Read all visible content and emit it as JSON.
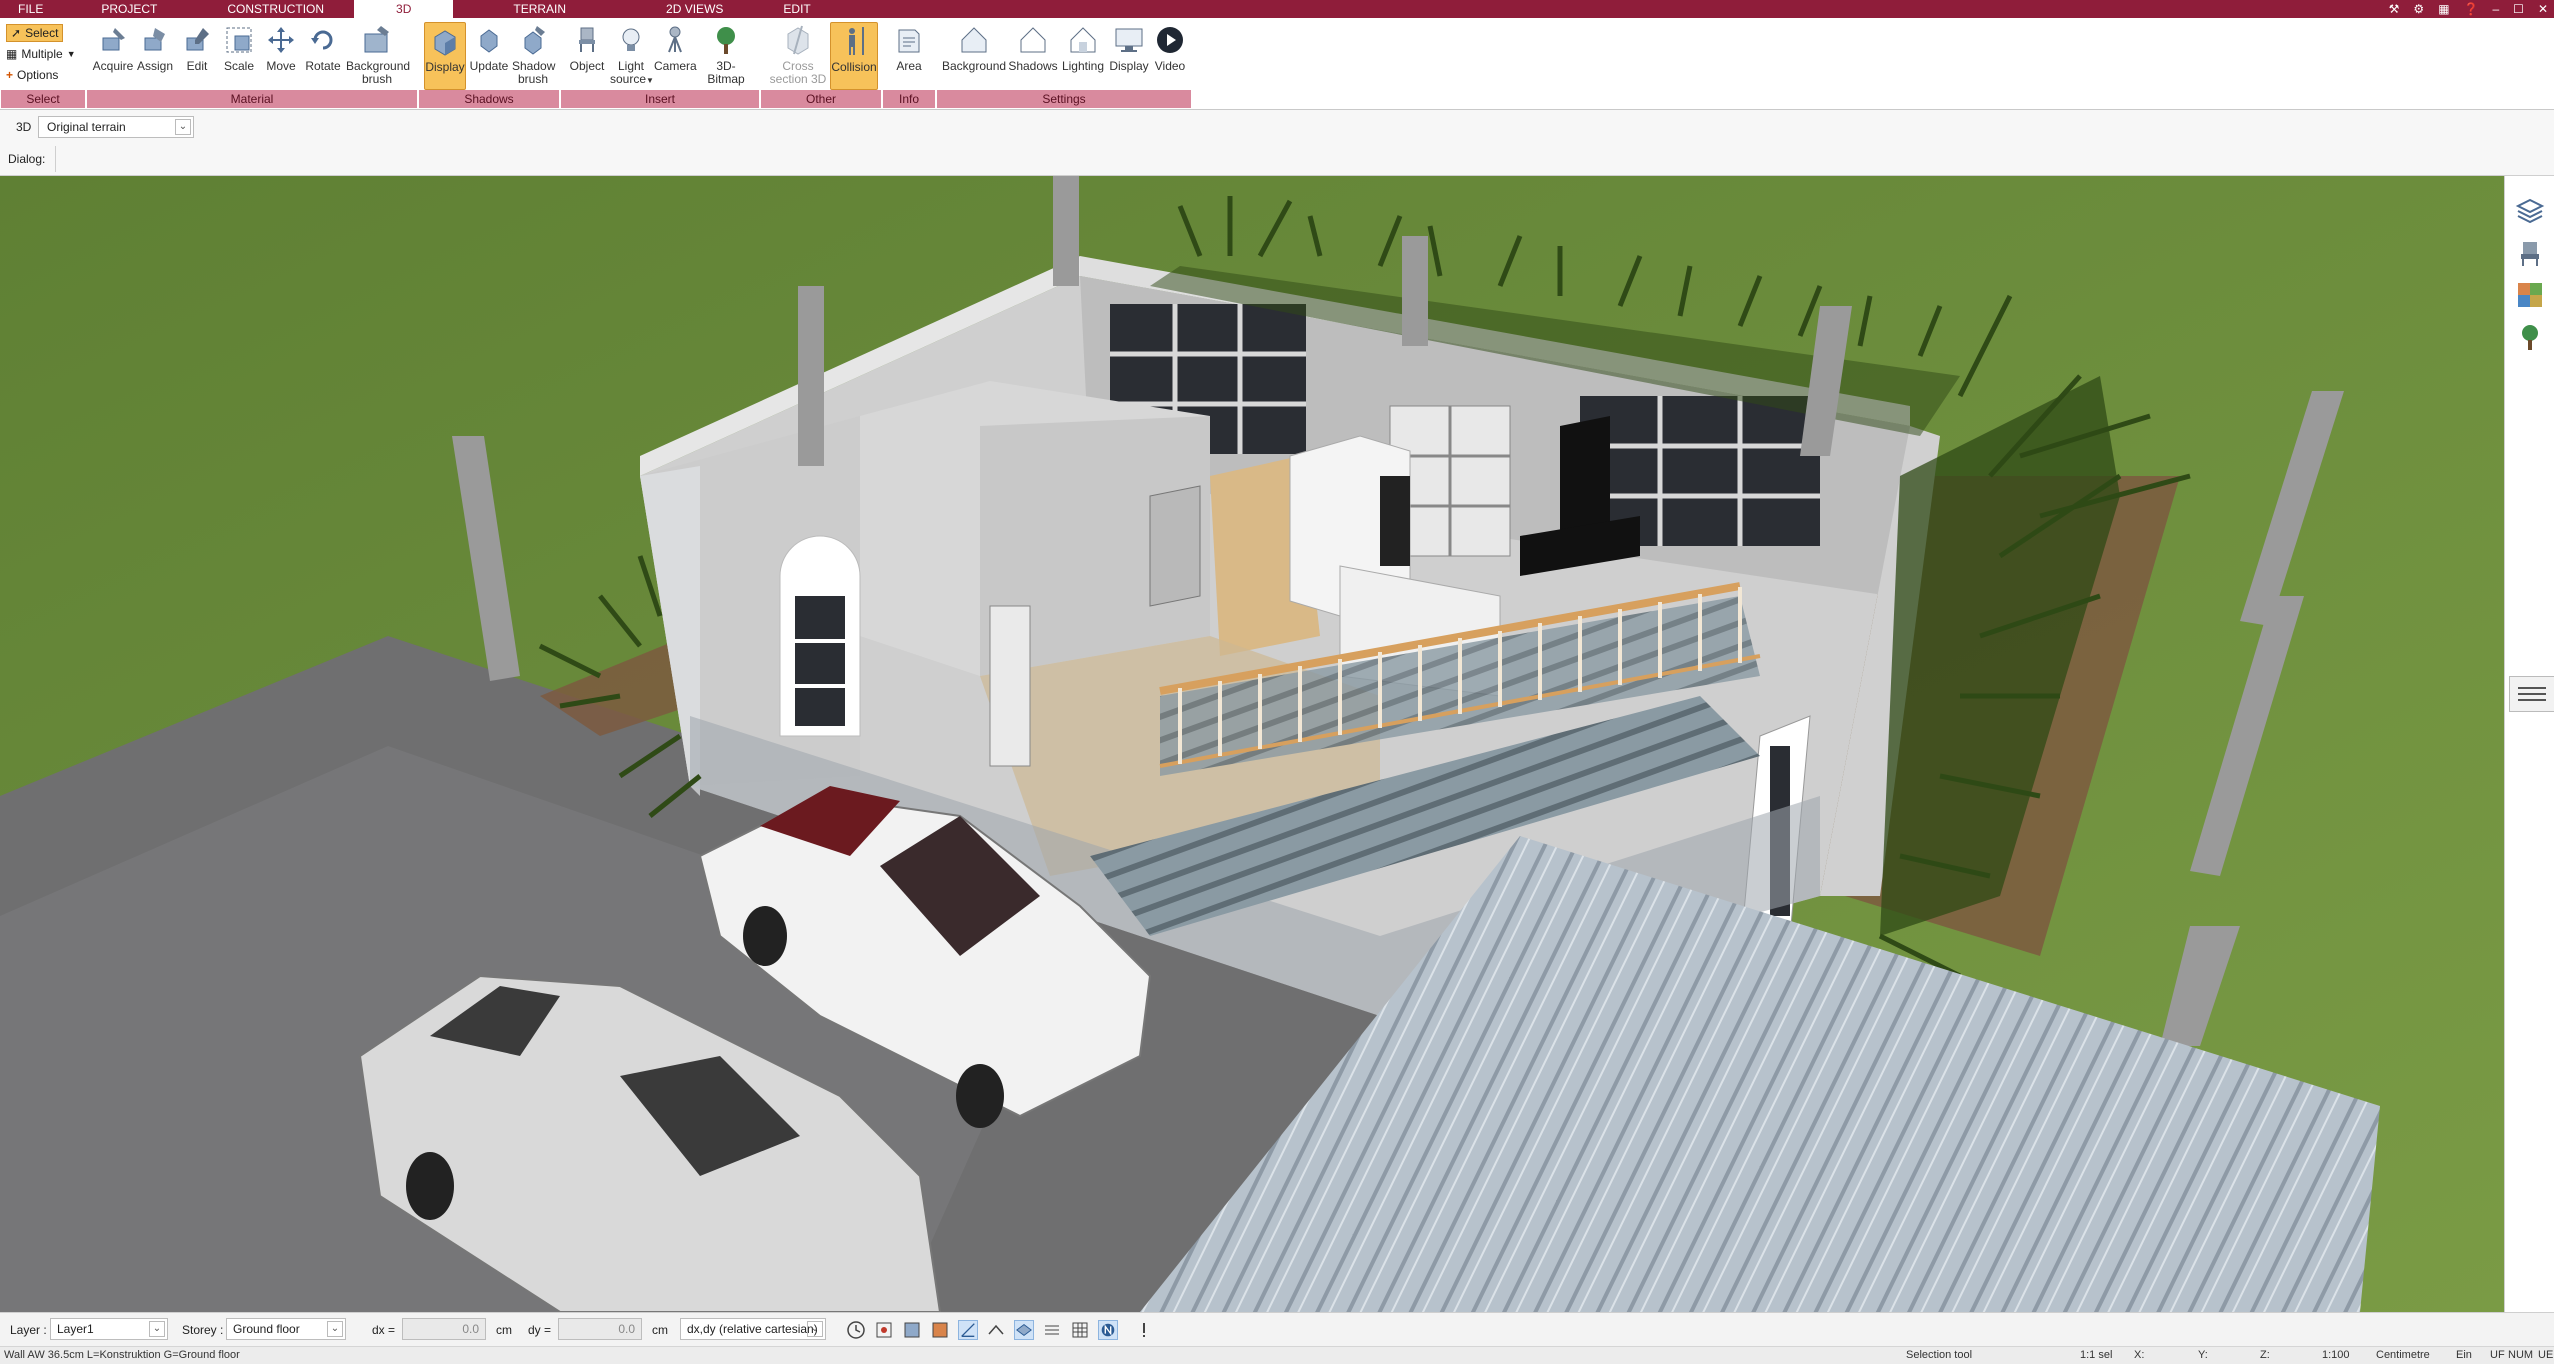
{
  "menu": {
    "tabs": [
      "FILE",
      "PROJECT",
      "CONSTRUCTION",
      "3D",
      "TERRAIN",
      "2D VIEWS",
      "EDIT"
    ],
    "active_tab": "3D"
  },
  "ribbon": {
    "select_group": {
      "select_label": "Select",
      "multiple_label": "Multiple",
      "options_label": "Options",
      "group_label": "Select"
    },
    "material_group": {
      "buttons": [
        "Acquire",
        "Assign",
        "Edit",
        "Scale",
        "Move",
        "Rotate"
      ],
      "background_brush_line1": "Background",
      "background_brush_line2": "brush",
      "group_label": "Material"
    },
    "shadows_group": {
      "display_label": "Display",
      "update_label": "Update",
      "shadow_brush_line1": "Shadow",
      "shadow_brush_line2": "brush",
      "group_label": "Shadows"
    },
    "insert_group": {
      "object_label": "Object",
      "light_source_line1": "Light",
      "light_source_line2": "source",
      "camera_label": "Camera",
      "bitmap_label": "3D-Bitmap",
      "group_label": "Insert"
    },
    "other_group": {
      "cross_section_line1": "Cross",
      "cross_section_line2": "section 3D",
      "collision_label": "Collision",
      "group_label": "Other"
    },
    "info_group": {
      "area_label": "Area",
      "group_label": "Info"
    },
    "settings_group": {
      "buttons": [
        "Background",
        "Shadows",
        "Lighting",
        "Display",
        "Video"
      ],
      "group_label": "Settings"
    }
  },
  "subbar": {
    "view_mode": "3D",
    "terrain_value": "Original terrain",
    "dialog_label": "Dialog:"
  },
  "bottombar": {
    "layer_label": "Layer :",
    "layer_value": "Layer1",
    "storey_label": "Storey :",
    "storey_value": "Ground floor",
    "dx_label": "dx =",
    "dx_value": "0.0",
    "dx_unit": "cm",
    "dy_label": "dy =",
    "dy_value": "0.0",
    "dy_unit": "cm",
    "coord_mode": "dx,dy (relative cartesian)"
  },
  "statusbar": {
    "info": "Wall AW 36.5cm L=Konstruktion G=Ground floor",
    "tool": "Selection tool",
    "scale_ratio": "1:1 sel",
    "x_label": "X:",
    "y_label": "Y:",
    "z_label": "Z:",
    "scale": "1:100",
    "unit": "Centimetre",
    "ein": "Ein",
    "uf": "UF",
    "num": "NUM",
    "ue": "UE"
  },
  "colors": {
    "accent": "#8f1d3a",
    "group_label_bg": "#d98a9e",
    "active_button": "#f7c25a",
    "grass": "#6a8a3b"
  }
}
